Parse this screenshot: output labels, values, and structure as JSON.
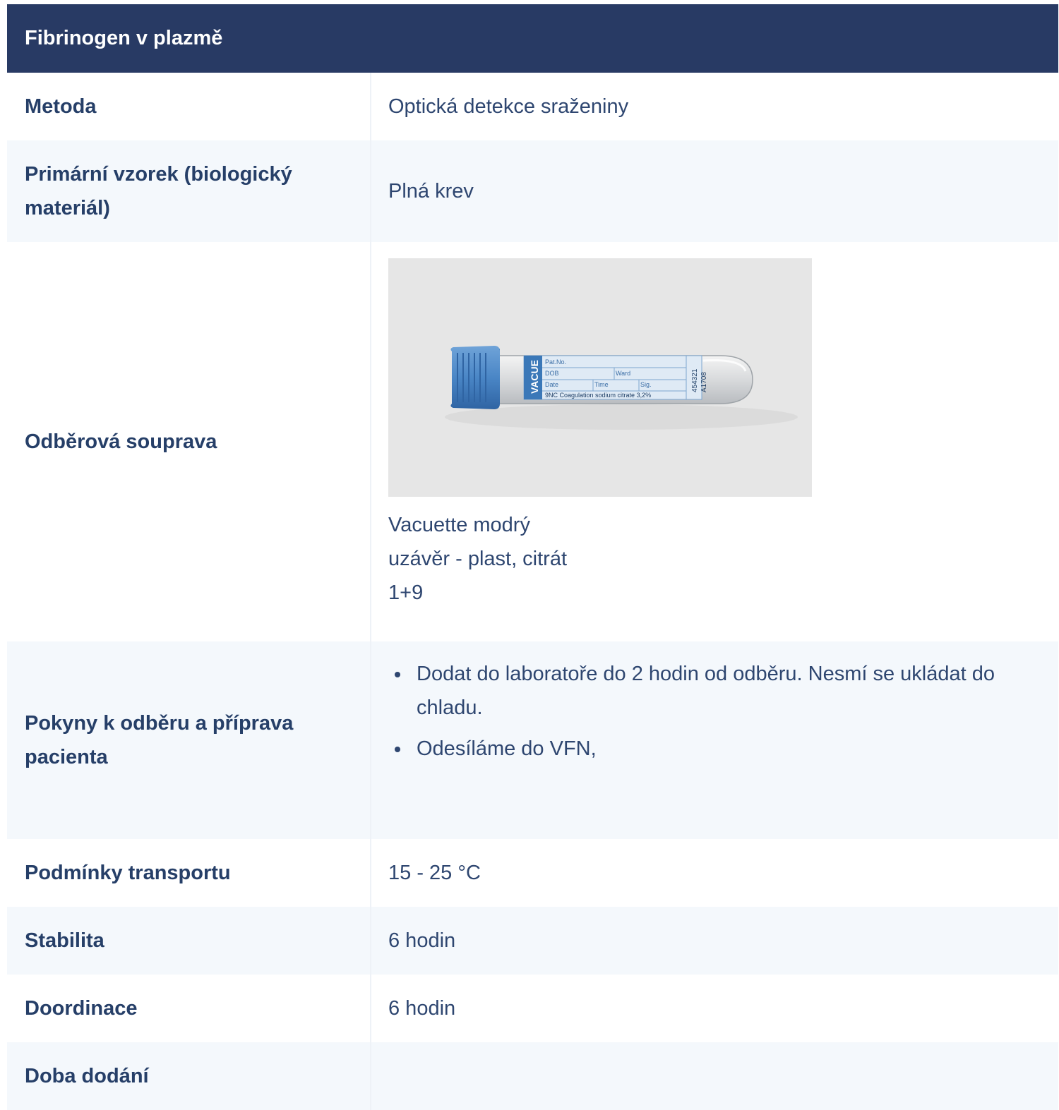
{
  "title": "Fibrinogen v plazmě",
  "rows": [
    {
      "label": "Metoda",
      "value": "Optická detekce sraženiny"
    },
    {
      "label": "Primární vzorek (biologický materiál)",
      "value": "Plná krev"
    },
    {
      "label": "Odběrová souprava",
      "image": {
        "icon": "blood-collection-tube-image",
        "cap_color": "#4a86c6",
        "tube_label": {
          "brand": "VACUE",
          "fields": [
            "Pat.No.",
            "DOB",
            "Ward",
            "Date",
            "Time",
            "Sig."
          ],
          "product": "9NC Coagulation sodium citrate 3,2%",
          "code1": "454321",
          "code2": "A1708"
        }
      },
      "caption_lines": [
        "Vacuette modrý",
        "uzávěr - plast, citrát",
        "1+9"
      ]
    },
    {
      "label": "Pokyny k odběru a příprava pacienta",
      "items": [
        "Dodat do laboratoře do 2 hodin od odběru. Nesmí se ukládat do chladu.",
        "Odesíláme do VFN,"
      ]
    },
    {
      "label": "Podmínky transportu",
      "value": "15 - 25 °C"
    },
    {
      "label": "Stabilita",
      "value": "6 hodin"
    },
    {
      "label": "Doordinace",
      "value": "6 hodin"
    },
    {
      "label": "Doba dodání",
      "value": ""
    }
  ],
  "colors": {
    "header_bg": "#283a64",
    "text": "#263f68",
    "stripe": "#f4f8fc"
  }
}
